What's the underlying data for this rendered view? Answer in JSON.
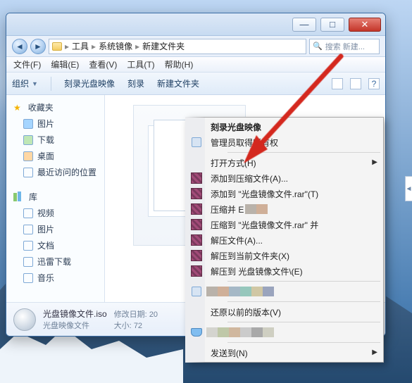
{
  "window_controls": {
    "min": "—",
    "max": "□",
    "close": "✕"
  },
  "breadcrumb": {
    "root": "工具",
    "mid": "系统镜像",
    "leaf": "新建文件夹"
  },
  "search_placeholder": "搜索 新建...",
  "menubar": {
    "file": "文件(F)",
    "edit": "编辑(E)",
    "view": "查看(V)",
    "tools": "工具(T)",
    "help": "帮助(H)"
  },
  "toolbar": {
    "organize": "组织",
    "burn": "刻录光盘映像",
    "burn_short": "刻录",
    "new_folder": "新建文件夹"
  },
  "sidebar": {
    "favorites_header": "收藏夹",
    "favorites": [
      {
        "label": "图片"
      },
      {
        "label": "下载"
      },
      {
        "label": "桌面"
      },
      {
        "label": "最近访问的位置"
      }
    ],
    "libraries_header": "库",
    "libraries": [
      {
        "label": "视频"
      },
      {
        "label": "图片"
      },
      {
        "label": "文档"
      },
      {
        "label": "迅雷下载"
      },
      {
        "label": "音乐"
      }
    ]
  },
  "status": {
    "file_name": "光盘镜像文件.iso",
    "file_type": "光盘映像文件",
    "date_label": "修改日期:",
    "date_value": "20",
    "size_label": "大小:",
    "size_value": "72"
  },
  "context_menu": {
    "items": [
      {
        "id": "burn-iso",
        "label": "刻录光盘映像",
        "bold": true
      },
      {
        "id": "admin",
        "label": "管理员取得所有权",
        "icon": "shell"
      },
      {
        "sep": true
      },
      {
        "id": "open-with",
        "label": "打开方式(H)",
        "submenu": true
      },
      {
        "id": "rar-add",
        "label": "添加到压缩文件(A)...",
        "icon": "rar"
      },
      {
        "id": "rar-add-named",
        "label": "添加到 \"光盘镜像文件.rar\"(T)",
        "icon": "rar"
      },
      {
        "id": "rar-zip-e",
        "label": "压缩并 E",
        "icon": "rar",
        "obscured": 1
      },
      {
        "id": "rar-zip-named",
        "label": "压缩到 \"光盘镜像文件.rar\" 并",
        "icon": "rar"
      },
      {
        "id": "extract",
        "label": "解压文件(A)...",
        "icon": "rar"
      },
      {
        "id": "extract-here",
        "label": "解压到当前文件夹(X)",
        "icon": "rar"
      },
      {
        "id": "extract-to",
        "label": "解压到 光盘镜像文件\\(E)",
        "icon": "rar"
      },
      {
        "sep": true
      },
      {
        "id": "obscured-row",
        "label": "",
        "obscured_row": 1,
        "icon": "shell"
      },
      {
        "sep": true
      },
      {
        "id": "prev-versions",
        "label": "还原以前的版本(V)"
      },
      {
        "sep": true
      },
      {
        "id": "obscured-row2",
        "label": "",
        "obscured_row": 2,
        "icon": "hand"
      },
      {
        "sep": true
      },
      {
        "id": "send-to",
        "label": "发送到(N)",
        "submenu": true
      }
    ]
  }
}
